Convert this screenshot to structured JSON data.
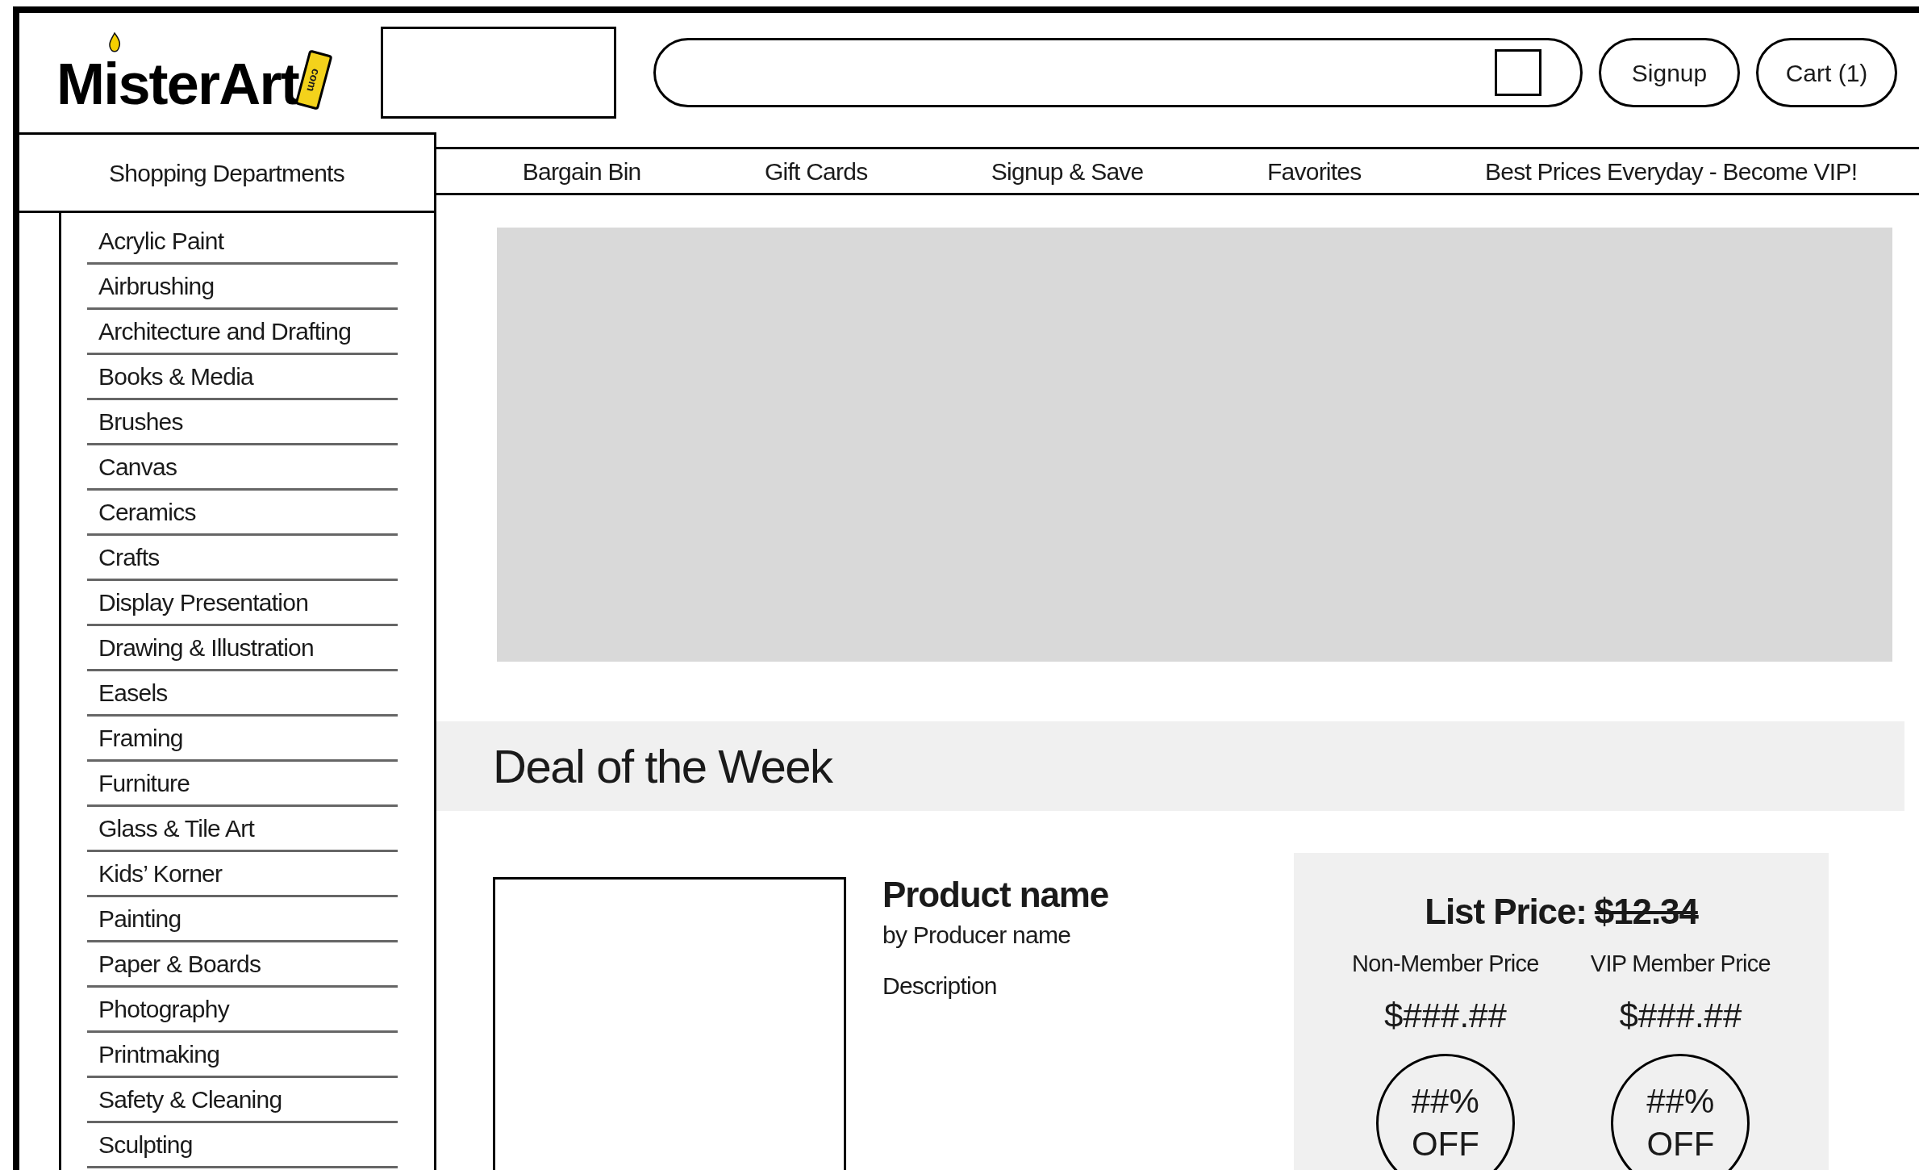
{
  "logo": {
    "name": "MisterArt",
    "suffix": "com"
  },
  "header": {
    "buttons": [
      "Signup",
      "Cart (1)"
    ]
  },
  "departments": {
    "title": "Shopping Departments",
    "items": [
      "Acrylic Paint",
      "Airbrushing",
      "Architecture and Drafting",
      "Books & Media",
      "Brushes",
      "Canvas",
      "Ceramics",
      "Crafts",
      "Display Presentation",
      "Drawing & Illustration",
      "Easels",
      "Framing",
      "Furniture",
      "Glass & Tile Art",
      "Kids’ Korner",
      "Painting",
      "Paper & Boards",
      "Photography",
      "Printmaking",
      "Safety & Cleaning",
      "Sculpting"
    ]
  },
  "nav": [
    "Bargain Bin",
    "Gift Cards",
    "Signup & Save",
    "Favorites",
    "Best Prices Everyday - Become VIP!"
  ],
  "deal": {
    "title": "Deal of the Week",
    "product": {
      "name": "Product name",
      "producer": "by Producer name",
      "description": "Description"
    },
    "list_price": {
      "label": "List Price:",
      "value": "$12.34",
      "struck": true
    },
    "prices": [
      {
        "label": "Non-Member Price",
        "price": "$###.##",
        "discount": "##%",
        "off": "OFF"
      },
      {
        "label": "VIP Member Price",
        "price": "$###.##",
        "discount": "##%",
        "off": "OFF"
      }
    ]
  }
}
